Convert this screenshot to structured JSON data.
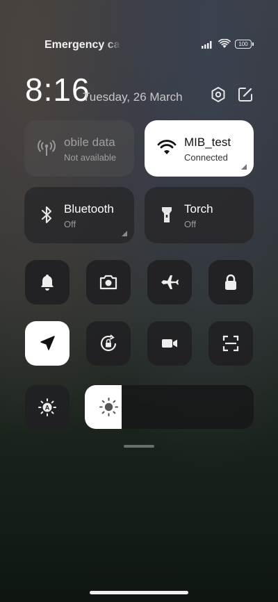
{
  "status_bar": {
    "carrier_text": "Emergency calls only",
    "battery": "100",
    "icons": [
      "signal-icon",
      "wifi-icon",
      "battery-icon"
    ]
  },
  "header": {
    "time": "8:16",
    "date": "Tuesday, 26 March",
    "icons": [
      "settings-icon",
      "edit-icon"
    ]
  },
  "large_tiles": [
    {
      "id": "mobile-data",
      "title": "obile data",
      "subtitle": "Not available",
      "icon": "antenna-icon",
      "state": "disabled"
    },
    {
      "id": "wifi",
      "title": "MIB_test",
      "subtitle": "Connected",
      "icon": "wifi-icon",
      "state": "on"
    },
    {
      "id": "bluetooth",
      "title": "Bluetooth",
      "subtitle": "Off",
      "icon": "bluetooth-icon",
      "state": "off"
    },
    {
      "id": "torch",
      "title": "Torch",
      "subtitle": "Off",
      "icon": "torch-icon",
      "state": "off"
    }
  ],
  "small_tiles_row1": [
    {
      "id": "sound",
      "icon": "bell-icon",
      "state": "off"
    },
    {
      "id": "screenshot",
      "icon": "camera-icon",
      "state": "off"
    },
    {
      "id": "airplane",
      "icon": "airplane-icon",
      "state": "off"
    },
    {
      "id": "lock",
      "icon": "lock-icon",
      "state": "off"
    }
  ],
  "small_tiles_row2": [
    {
      "id": "location",
      "icon": "location-arrow-icon",
      "state": "on"
    },
    {
      "id": "rotation-lock",
      "icon": "rotation-lock-icon",
      "state": "off"
    },
    {
      "id": "screen-record",
      "icon": "video-camera-icon",
      "state": "off"
    },
    {
      "id": "scanner",
      "icon": "scan-icon",
      "state": "off"
    }
  ],
  "brightness": {
    "auto_icon": "auto-brightness-icon",
    "level": 0.22
  },
  "colors": {
    "tile_on": "#ffffff",
    "tile_off": "#28282a"
  }
}
